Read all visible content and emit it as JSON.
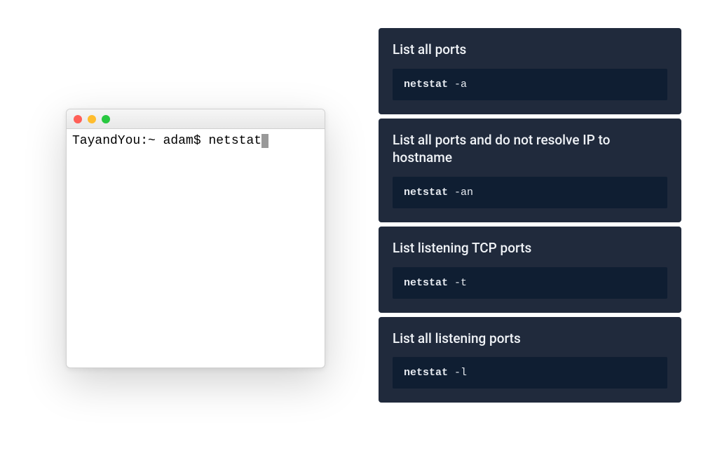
{
  "terminal": {
    "prompt": "TayandYou:~ adam$ ",
    "typed": "netstat"
  },
  "cards": [
    {
      "title": "List all ports",
      "command": "netstat",
      "args": " -a"
    },
    {
      "title": "List all ports and do not resolve IP to hostname",
      "command": "netstat",
      "args": " -an"
    },
    {
      "title": "List listening TCP ports",
      "command": "netstat",
      "args": " -t"
    },
    {
      "title": "List all listening ports",
      "command": "netstat",
      "args": " -l"
    }
  ]
}
